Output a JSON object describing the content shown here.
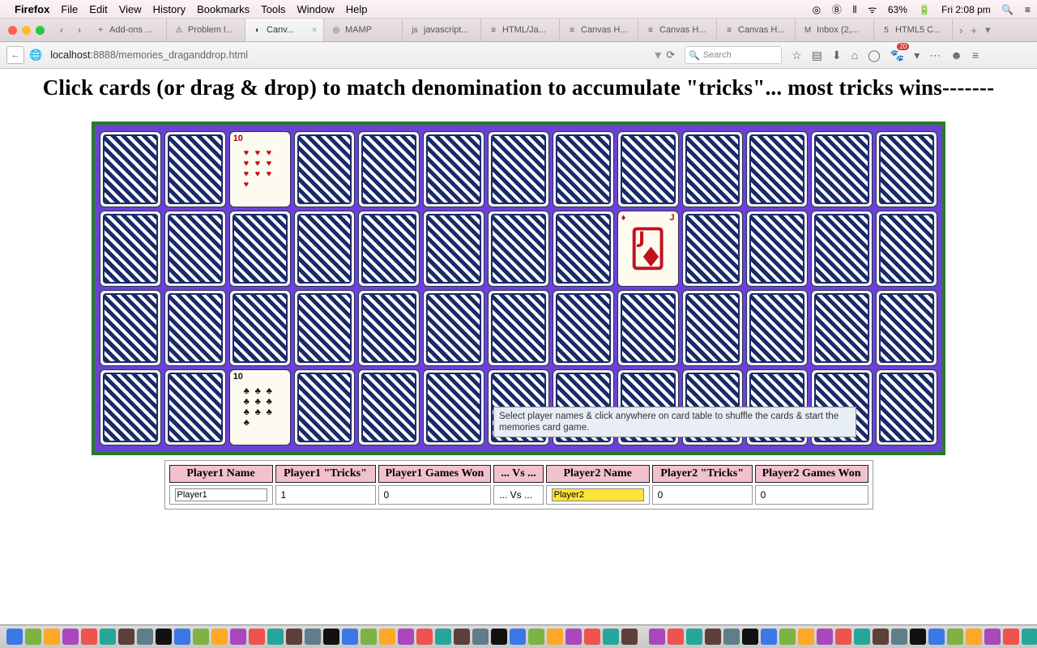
{
  "menubar": {
    "app": "Firefox",
    "items": [
      "File",
      "Edit",
      "View",
      "History",
      "Bookmarks",
      "Tools",
      "Window",
      "Help"
    ],
    "battery": "63%",
    "clock": "Fri 2:08 pm"
  },
  "tabs": {
    "items": [
      {
        "label": "Add-ons ...",
        "fav": "+"
      },
      {
        "label": "Problem l...",
        "fav": "⚠"
      },
      {
        "label": "Canv...",
        "fav": "◐",
        "active": true,
        "close": "×"
      },
      {
        "label": "MAMP",
        "fav": "◎"
      },
      {
        "label": "javascript...",
        "fav": "js"
      },
      {
        "label": "HTML/Ja...",
        "fav": "≡"
      },
      {
        "label": "Canvas H...",
        "fav": "≡"
      },
      {
        "label": "Canvas H...",
        "fav": "≡"
      },
      {
        "label": "Canvas H...",
        "fav": "≡"
      },
      {
        "label": "Inbox (2,...",
        "fav": "M"
      },
      {
        "label": "HTML5 C...",
        "fav": "5"
      }
    ]
  },
  "urlbar": {
    "host": "localhost",
    "path": ":8888/memories_draganddrop.html",
    "search_placeholder": "Search",
    "badge_count": "20"
  },
  "page": {
    "heading": "Click cards (or drag & drop) to match denomination to accumulate \"tricks\"... most tricks wins-------",
    "tooltip": "Select player names & click anywhere on card table to shuffle the cards & start the memories card game."
  },
  "cards": {
    "rank_ten": "10",
    "rank_jack": "J"
  },
  "scoreboard": {
    "headers": [
      "Player1 Name",
      "Player1 \"Tricks\"",
      "Player1 Games Won",
      "... Vs ...",
      "Player2 Name",
      "Player2 \"Tricks\"",
      "Player2 Games Won"
    ],
    "p1_name": "Player1",
    "p1_tricks": "1",
    "p1_won": "0",
    "vs": "... Vs ...",
    "p2_name": "Player2",
    "p2_tricks": "0",
    "p2_won": "0"
  }
}
